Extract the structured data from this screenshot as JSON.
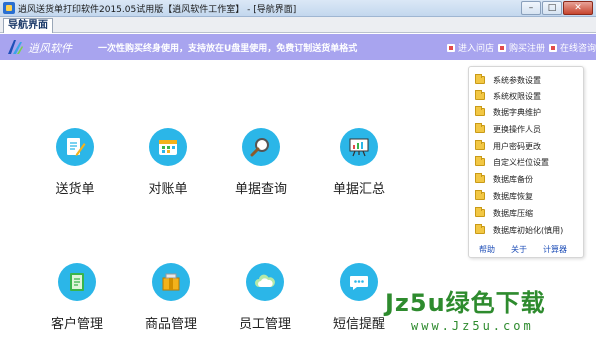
{
  "window": {
    "title": "逍风送货单打印软件2015.05试用版【逍风软件工作室】 - [导航界面]",
    "btn_minimize": "–",
    "btn_maximize": "□",
    "btn_close": "✕"
  },
  "tabs": [
    {
      "label": "导航界面"
    }
  ],
  "header": {
    "logo_text": "逍风软件",
    "slogan": "一次性购买终身使用，支持放在U盘里使用，免费订制送货单格式",
    "links": [
      {
        "label": "进入问店"
      },
      {
        "label": "购买注册"
      },
      {
        "label": "在线咨询"
      }
    ]
  },
  "features": [
    {
      "label": "送货单",
      "icon": "pencil-notepad-icon",
      "color": "#2bb6e8"
    },
    {
      "label": "对账单",
      "icon": "calendar-icon",
      "color": "#2bb6e8"
    },
    {
      "label": "单据查询",
      "icon": "magnifier-icon",
      "color": "#2bb6e8"
    },
    {
      "label": "单据汇总",
      "icon": "presentation-board-icon",
      "color": "#2bb6e8"
    },
    {
      "label": "客户管理",
      "icon": "address-book-icon",
      "color": "#39b54a"
    },
    {
      "label": "商品管理",
      "icon": "package-icon",
      "color": "#f3b21b"
    },
    {
      "label": "员工管理",
      "icon": "cloud-icon",
      "color": "#2bb6e8"
    },
    {
      "label": "短信提醒",
      "icon": "chat-bubble-icon",
      "color": "#2bb6e8"
    }
  ],
  "side_panel": {
    "items": [
      {
        "label": "系统参数设置"
      },
      {
        "label": "系统权限设置"
      },
      {
        "label": "数据字典维护"
      },
      {
        "label": "更换操作人员"
      },
      {
        "label": "用户密码更改"
      },
      {
        "label": "自定义栏位设置"
      },
      {
        "label": "数据库备份"
      },
      {
        "label": "数据库恢复"
      },
      {
        "label": "数据库压缩"
      },
      {
        "label": "数据库初始化(慎用)"
      }
    ],
    "links": [
      {
        "label": "帮助"
      },
      {
        "label": "关于"
      },
      {
        "label": "计算器"
      }
    ]
  },
  "watermark": {
    "main": "Jz5u绿色下载",
    "sub": "www.Jz5u.com"
  }
}
